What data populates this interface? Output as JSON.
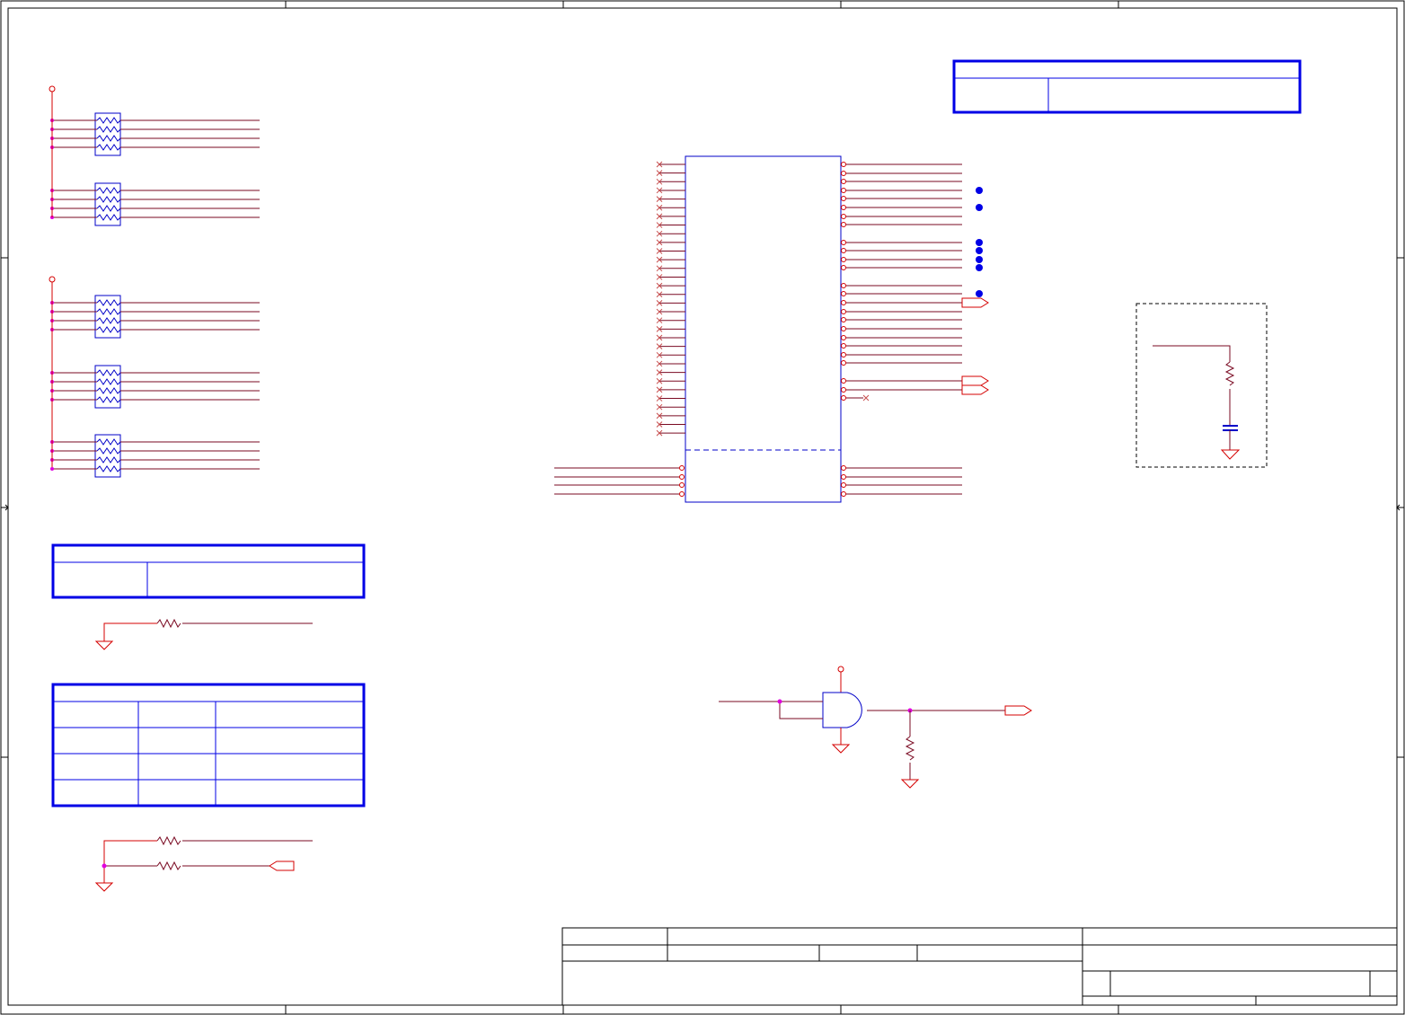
{
  "sheet": {
    "frame_color": "#000000",
    "wire_color": "#7a0a22",
    "part_color": "#0000c8",
    "power_color": "#d40000",
    "junction_color": "#e000e0",
    "unconnected_color": "#c85050",
    "title_block_text": ""
  },
  "schematic": {
    "resistor_packs": {
      "count": 5,
      "resistors_per_pack": 4
    },
    "main_ic": {
      "left_unconnected_pins": 32,
      "right_pins": 27,
      "bottom_left_pins": 4,
      "bottom_right_pins": 4
    },
    "test_points": 7,
    "and_gate": 1,
    "tables": 4
  }
}
